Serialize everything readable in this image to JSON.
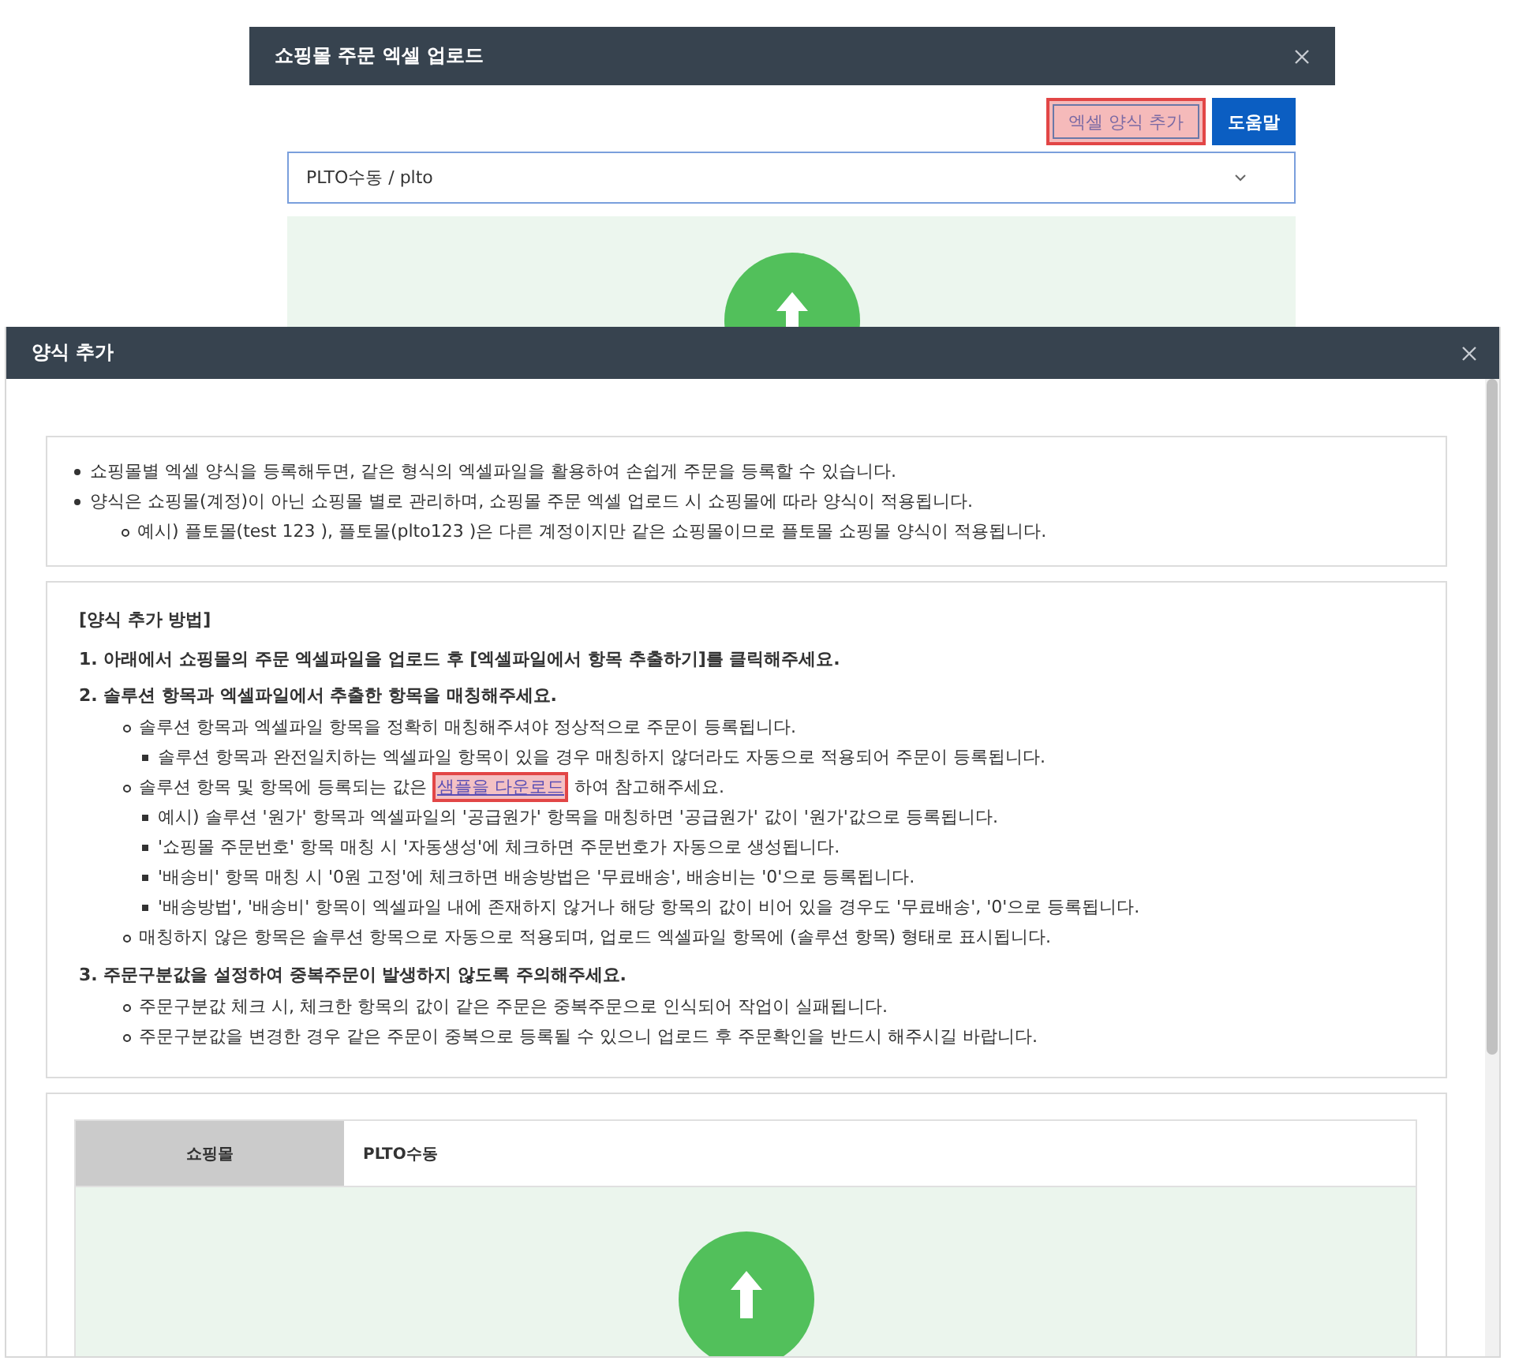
{
  "back_window": {
    "title": "쇼핑몰 주문 엑셀 업로드",
    "buttons": [
      {
        "label": "엑셀 양식 추가",
        "kind": "secondary",
        "highlighted": true
      },
      {
        "label": "도움말",
        "kind": "primary",
        "highlighted": false
      }
    ],
    "select": {
      "value": "PLTO수동 / plto"
    }
  },
  "front_window": {
    "title": "양식 추가",
    "intro": [
      {
        "text": "쇼핑몰별 엑셀 양식을 등록해두면, 같은 형식의 엑셀파일을 활용하여 손쉽게 주문을 등록할 수 있습니다."
      },
      {
        "text": "양식은 쇼핑몰(계정)이 아닌 쇼핑몰 별로 관리하며, 쇼핑몰 주문 엑셀 업로드 시 쇼핑몰에 따라 양식이 적용됩니다.",
        "children": [
          {
            "text": "예시) 플토몰(test 123 ), 플토몰(plto123 )은 다른 계정이지만 같은 쇼핑몰이므로 플토몰 쇼핑몰 양식이 적용됩니다."
          }
        ]
      }
    ],
    "guide": {
      "heading": "[양식 추가 방법]",
      "steps": [
        {
          "text": "1. 아래에서 쇼핑몰의 주문 엑셀파일을 업로드 후 [엑셀파일에서 항목 추출하기]를 클릭해주세요."
        },
        {
          "text": "2. 솔루션 항목과 엑셀파일에서 추출한 항목을 매칭해주세요.",
          "children": [
            {
              "text": "솔루션 항목과 엑셀파일 항목을 정확히 매칭해주셔야 정상적으로 주문이 등록됩니다.",
              "children": [
                {
                  "text": "솔루션 항목과 완전일치하는 엑셀파일 항목이 있을 경우 매칭하지 않더라도 자동으로 적용되어 주문이 등록됩니다."
                }
              ]
            },
            {
              "parts": [
                {
                  "text": "솔루션 항목 및 항목에 등록되는 값은 "
                },
                {
                  "text": "샘플을 다운로드",
                  "kind": "link",
                  "highlighted": true
                },
                {
                  "text": " 하여 참고해주세요."
                }
              ],
              "children": [
                {
                  "text": "예시) 솔루션 '원가' 항목과 엑셀파일의 '공급원가' 항목을 매칭하면 '공급원가' 값이 '원가'값으로 등록됩니다."
                },
                {
                  "text": "'쇼핑몰 주문번호' 항목 매칭 시 '자동생성'에 체크하면 주문번호가 자동으로 생성됩니다."
                },
                {
                  "text": "'배송비' 항목 매칭 시 '0원 고정'에 체크하면 배송방법은 '무료배송', 배송비는 '0'으로 등록됩니다."
                },
                {
                  "text": "'배송방법', '배송비' 항목이 엑셀파일 내에 존재하지 않거나 해당 항목의 값이 비어 있을 경우도 '무료배송', '0'으로 등록됩니다."
                }
              ]
            },
            {
              "text": "매칭하지 않은 항목은 솔루션 항목으로 자동으로 적용되며, 업로드 엑셀파일 항목에 (솔루션 항목) 형태로 표시됩니다."
            }
          ]
        },
        {
          "text": "3. 주문구분값을 설정하여 중복주문이 발생하지 않도록 주의해주세요.",
          "children": [
            {
              "text": "주문구분값 체크 시, 체크한 항목의 값이 같은 주문은 중복주문으로 인식되어 작업이 실패됩니다."
            },
            {
              "text": "주문구분값을 변경한 경우 같은 주문이 중복으로 등록될 수 있으니 업로드 후 주문확인을 반드시 해주시길 바랍니다."
            }
          ]
        }
      ]
    },
    "table": {
      "label": "쇼핑몰",
      "value": "PLTO수동"
    }
  }
}
